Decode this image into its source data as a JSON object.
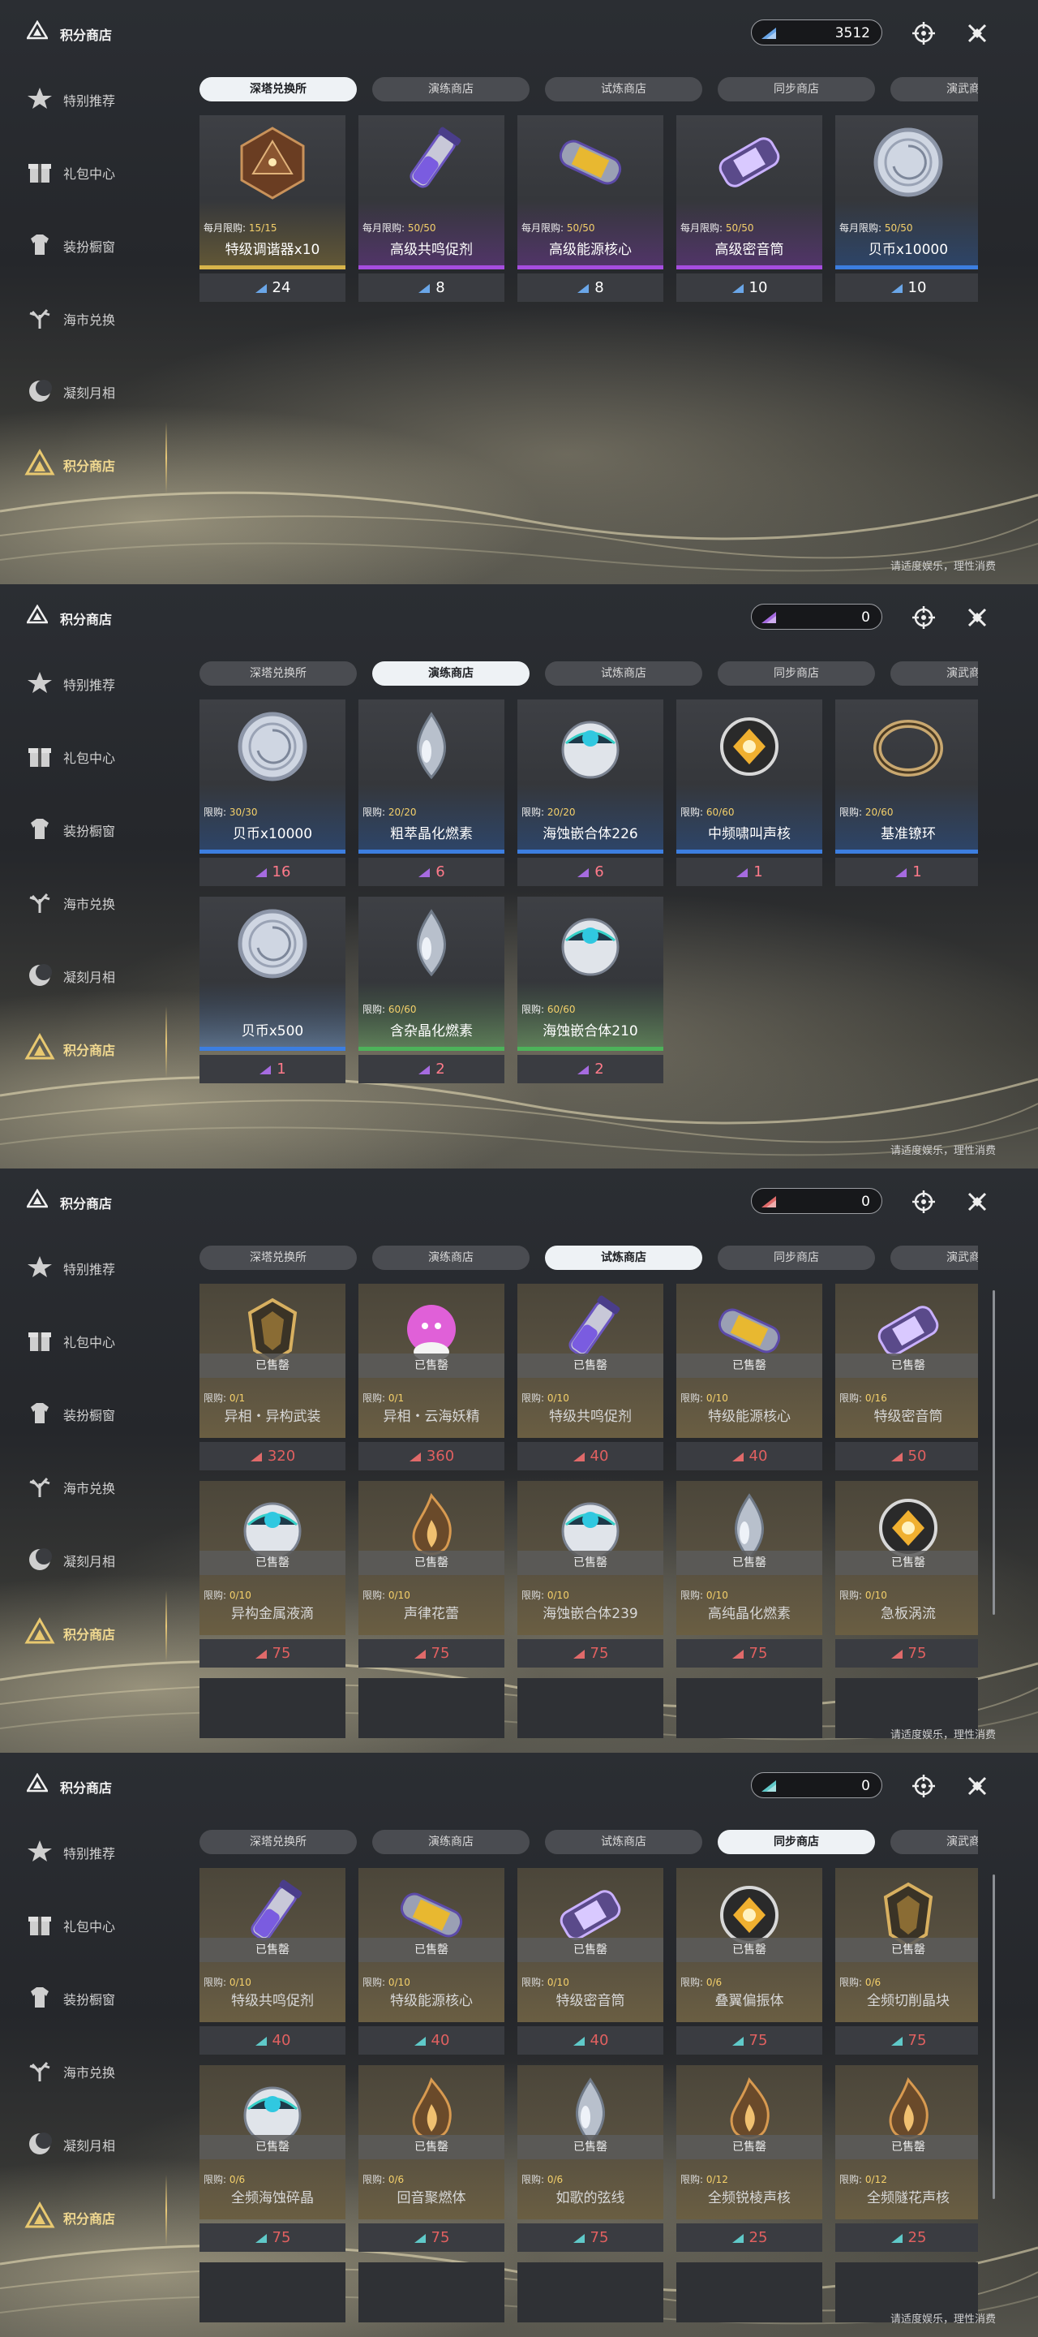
{
  "app_title": "积分商店",
  "sidebar": [
    {
      "label": "特别推荐",
      "icon": "star-hand-icon"
    },
    {
      "label": "礼包中心",
      "icon": "gift-icon"
    },
    {
      "label": "装扮橱窗",
      "icon": "shirt-icon"
    },
    {
      "label": "海市兑换",
      "icon": "coral-icon"
    },
    {
      "label": "凝刻月相",
      "icon": "moon-icon"
    },
    {
      "label": "积分商店",
      "icon": "triangle-logo-icon",
      "active": true
    }
  ],
  "tabs": [
    "深塔兑换所",
    "演练商店",
    "试炼商店",
    "同步商店",
    "演武商店"
  ],
  "notice": "请适度娱乐，理性消费",
  "colors": {
    "rarity_gold": "#d8b44a",
    "rarity_purple": "#a64de0",
    "rarity_blue": "#3c7ee0",
    "rarity_green": "#4db35a",
    "limit_yellow": "#f4d06a",
    "price_red": "#e06060"
  },
  "panels": [
    {
      "active_tab": 0,
      "currency": {
        "value": "3512",
        "color": "#6aa6e8"
      },
      "price_color": "#ffffff",
      "items": [
        {
          "limit_label": "每月限购:",
          "limit": "15/15",
          "name": "特级调谐器x10",
          "price": "24",
          "rarity": "gold",
          "art": "d20"
        },
        {
          "limit_label": "每月限购:",
          "limit": "50/50",
          "name": "高级共鸣促剂",
          "price": "8",
          "rarity": "purple",
          "art": "vial"
        },
        {
          "limit_label": "每月限购:",
          "limit": "50/50",
          "name": "高级能源核心",
          "price": "8",
          "rarity": "purple",
          "art": "capsule"
        },
        {
          "limit_label": "每月限购:",
          "limit": "50/50",
          "name": "高级密音筒",
          "price": "10",
          "rarity": "purple",
          "art": "tube"
        },
        {
          "limit_label": "每月限购:",
          "limit": "50/50",
          "name": "贝币x10000",
          "price": "10",
          "rarity": "blue",
          "art": "coin"
        }
      ]
    },
    {
      "active_tab": 1,
      "currency": {
        "value": "0",
        "color": "#a66be0"
      },
      "price_color": "#ff7a8a",
      "items": [
        {
          "limit_label": "限购:",
          "limit": "30/30",
          "name": "贝币x10000",
          "price": "16",
          "rarity": "blue",
          "art": "coin"
        },
        {
          "limit_label": "限购:",
          "limit": "20/20",
          "name": "粗萃晶化燃素",
          "price": "6",
          "rarity": "blue",
          "art": "drop"
        },
        {
          "limit_label": "限购:",
          "limit": "20/20",
          "name": "海蚀嵌合体226",
          "price": "6",
          "rarity": "blue",
          "art": "orb"
        },
        {
          "limit_label": "限购:",
          "limit": "60/60",
          "name": "中频啸叫声核",
          "price": "1",
          "rarity": "blue",
          "art": "core"
        },
        {
          "limit_label": "限购:",
          "limit": "20/60",
          "name": "基准镣环",
          "price": "1",
          "rarity": "blue",
          "art": "ring"
        },
        {
          "limit_label": "",
          "limit": "",
          "name": "贝币x500",
          "price": "1",
          "rarity": "blue",
          "art": "coin"
        },
        {
          "limit_label": "限购:",
          "limit": "60/60",
          "name": "含杂晶化燃素",
          "price": "2",
          "rarity": "green",
          "art": "drop"
        },
        {
          "limit_label": "限购:",
          "limit": "60/60",
          "name": "海蚀嵌合体210",
          "price": "2",
          "rarity": "green",
          "art": "orb"
        }
      ]
    },
    {
      "active_tab": 2,
      "currency": {
        "value": "0",
        "color": "#e06a6a"
      },
      "price_color": "#e06060",
      "sold_label": "已售罄",
      "items": [
        {
          "limit_label": "限购:",
          "limit": "0/1",
          "name": "异相・异构武装",
          "price": "320",
          "art": "armor"
        },
        {
          "limit_label": "限购:",
          "limit": "0/1",
          "name": "异相・云海妖精",
          "price": "360",
          "art": "fairy"
        },
        {
          "limit_label": "限购:",
          "limit": "0/10",
          "name": "特级共鸣促剂",
          "price": "40",
          "art": "vial"
        },
        {
          "limit_label": "限购:",
          "limit": "0/10",
          "name": "特级能源核心",
          "price": "40",
          "art": "capsule"
        },
        {
          "limit_label": "限购:",
          "limit": "0/16",
          "name": "特级密音筒",
          "price": "50",
          "art": "tube"
        },
        {
          "limit_label": "限购:",
          "limit": "0/10",
          "name": "异构金属液滴",
          "price": "75",
          "art": "orb"
        },
        {
          "limit_label": "限购:",
          "limit": "0/10",
          "name": "声律花蕾",
          "price": "75",
          "art": "flame"
        },
        {
          "limit_label": "限购:",
          "limit": "0/10",
          "name": "海蚀嵌合体239",
          "price": "75",
          "art": "orb"
        },
        {
          "limit_label": "限购:",
          "limit": "0/10",
          "name": "高纯晶化燃素",
          "price": "75",
          "art": "drop"
        },
        {
          "limit_label": "限购:",
          "limit": "0/10",
          "name": "急板涡流",
          "price": "75",
          "art": "core"
        }
      ]
    },
    {
      "active_tab": 3,
      "currency": {
        "value": "0",
        "color": "#5fc9c9"
      },
      "price_color": "#e06060",
      "sold_label": "已售罄",
      "items": [
        {
          "limit_label": "限购:",
          "limit": "0/10",
          "name": "特级共鸣促剂",
          "price": "40",
          "art": "vial"
        },
        {
          "limit_label": "限购:",
          "limit": "0/10",
          "name": "特级能源核心",
          "price": "40",
          "art": "capsule"
        },
        {
          "limit_label": "限购:",
          "limit": "0/10",
          "name": "特级密音筒",
          "price": "40",
          "art": "tube"
        },
        {
          "limit_label": "限购:",
          "limit": "0/6",
          "name": "叠翼偏振体",
          "price": "75",
          "art": "core"
        },
        {
          "limit_label": "限购:",
          "limit": "0/6",
          "name": "全频切削晶块",
          "price": "75",
          "art": "armor"
        },
        {
          "limit_label": "限购:",
          "limit": "0/6",
          "name": "全频海蚀碎晶",
          "price": "75",
          "art": "orb"
        },
        {
          "limit_label": "限购:",
          "limit": "0/6",
          "name": "回音聚燃体",
          "price": "75",
          "art": "flame"
        },
        {
          "limit_label": "限购:",
          "limit": "0/6",
          "name": "如歌的弦线",
          "price": "75",
          "art": "drop"
        },
        {
          "limit_label": "限购:",
          "limit": "0/12",
          "name": "全频锐棱声核",
          "price": "25",
          "art": "flame"
        },
        {
          "limit_label": "限购:",
          "limit": "0/12",
          "name": "全频隧花声核",
          "price": "25",
          "art": "flame"
        }
      ]
    }
  ]
}
